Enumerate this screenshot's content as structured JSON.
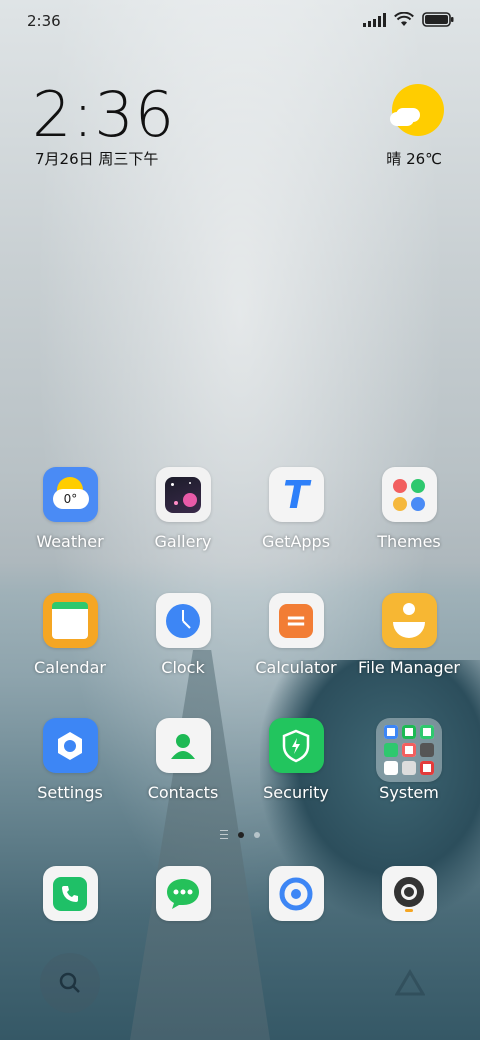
{
  "status_bar": {
    "time": "2:36"
  },
  "lockscreen_widget": {
    "clock": "2:36",
    "date": "7月26日 周三下午",
    "weather": "晴 26℃"
  },
  "apps": [
    {
      "label": "Weather",
      "icon": "weather-icon",
      "badge_text": "0°"
    },
    {
      "label": "Gallery",
      "icon": "gallery-icon"
    },
    {
      "label": "GetApps",
      "icon": "getapps-icon",
      "glyph": "T"
    },
    {
      "label": "Themes",
      "icon": "themes-icon"
    },
    {
      "label": "Calendar",
      "icon": "calendar-icon"
    },
    {
      "label": "Clock",
      "icon": "clock-icon"
    },
    {
      "label": "Calculator",
      "icon": "calculator-icon",
      "glyph": "="
    },
    {
      "label": "File Manager",
      "icon": "file-manager-icon"
    },
    {
      "label": "Settings",
      "icon": "settings-icon"
    },
    {
      "label": "Contacts",
      "icon": "contacts-icon"
    },
    {
      "label": "Security",
      "icon": "security-icon"
    },
    {
      "label": "System",
      "icon": "system-folder-icon"
    }
  ],
  "dock": [
    {
      "name": "phone",
      "icon": "phone-icon"
    },
    {
      "name": "messages",
      "icon": "messages-icon"
    },
    {
      "name": "browser",
      "icon": "browser-icon"
    },
    {
      "name": "camera",
      "icon": "camera-icon"
    }
  ],
  "colors": {
    "weather_blue": "#4a8bf5",
    "sun_yellow": "#ffcd00",
    "getapps_blue": "#2d7ff9",
    "calendar_orange": "#f5a623",
    "calculator_orange": "#f27d35",
    "settings_blue": "#3d86f5",
    "contacts_green": "#1db954",
    "security_green": "#22c55e",
    "phone_green": "#1fc067",
    "messages_green": "#25c15a"
  }
}
